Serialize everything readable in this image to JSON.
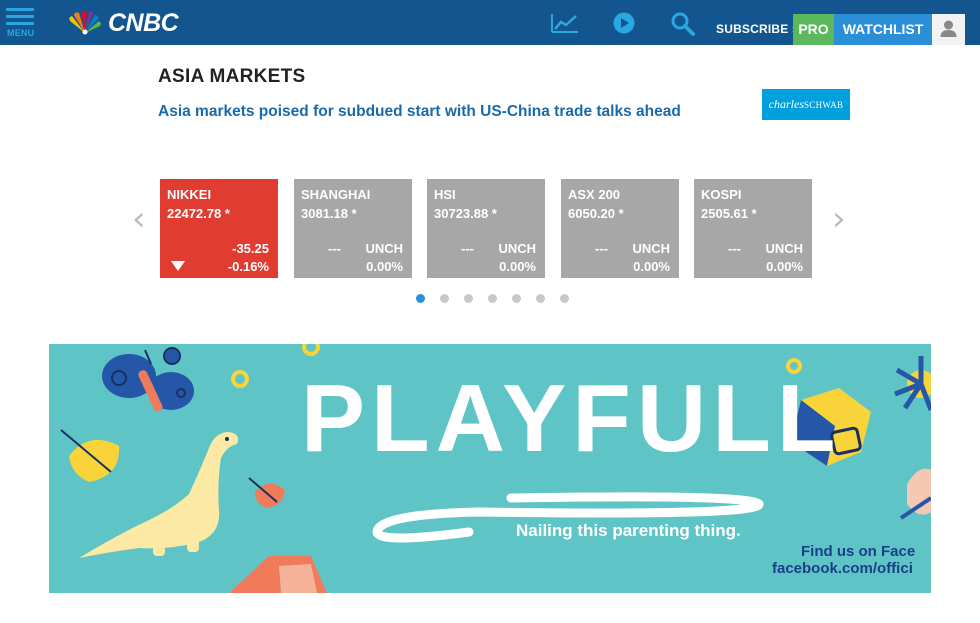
{
  "header": {
    "menu_label": "MENU",
    "logo_text": "CNBC",
    "subscribe_label": "SUBSCRIBE ›",
    "pro_label": "PRO",
    "watchlist_label": "WATCHLIST",
    "icons": [
      "menu-icon",
      "peacock-logo-icon",
      "chart-icon",
      "play-icon",
      "search-icon",
      "user-icon"
    ]
  },
  "markets": {
    "title": "ASIA MARKETS",
    "headline": "Asia markets poised for subdued start with US-China trade talks ahead",
    "sponsor": {
      "script": "charles",
      "caps": "SCHWAB"
    },
    "prev_arrow": "‹",
    "next_arrow": "›",
    "cards": [
      {
        "name": "NIKKEI",
        "price": "22472.78 *",
        "change": "-35.25",
        "percent": "-0.16%",
        "direction": "down"
      },
      {
        "name": "SHANGHAI",
        "price": "3081.18 *",
        "dash": "---",
        "change": "UNCH",
        "percent": "0.00%",
        "direction": "flat"
      },
      {
        "name": "HSI",
        "price": "30723.88 *",
        "dash": "---",
        "change": "UNCH",
        "percent": "0.00%",
        "direction": "flat"
      },
      {
        "name": "ASX 200",
        "price": "6050.20 *",
        "dash": "---",
        "change": "UNCH",
        "percent": "0.00%",
        "direction": "flat"
      },
      {
        "name": "KOSPI",
        "price": "2505.61 *",
        "dash": "---",
        "change": "UNCH",
        "percent": "0.00%",
        "direction": "flat"
      }
    ],
    "page_count": 7,
    "active_page": 1
  },
  "banner": {
    "title": "PLAYFULL",
    "tagline": "Nailing this parenting thing.",
    "find_us": "Find us on Face",
    "url": "facebook.com/offici"
  },
  "colors": {
    "header_bg": "#13568f",
    "accent_blue": "#2a8fd6",
    "pro_green": "#5cb85c",
    "negative_red": "#e03c31",
    "neutral_gray": "#a7a7a7",
    "banner_teal": "#5fc4c6"
  }
}
